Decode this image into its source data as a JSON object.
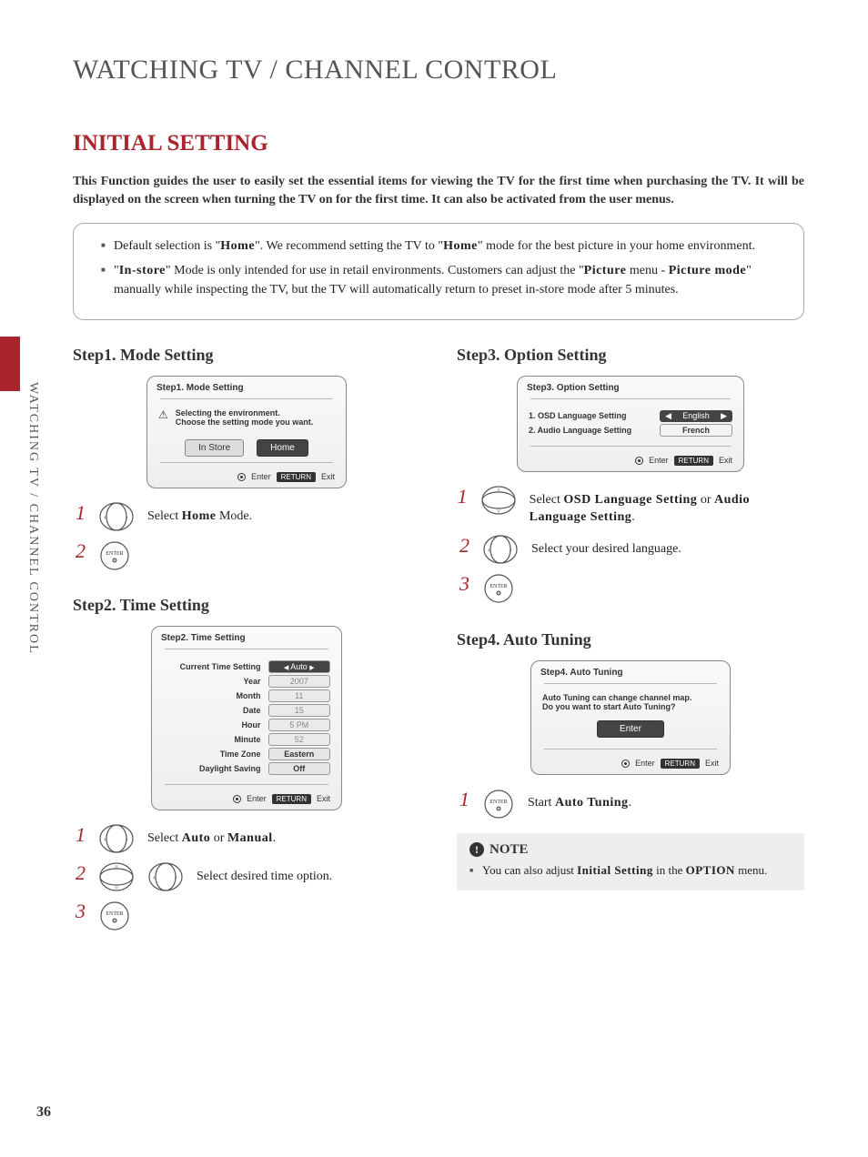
{
  "page": {
    "main_title": "WATCHING TV / CHANNEL CONTROL",
    "section_title": "INITIAL SETTING",
    "sidebar_label": "WATCHING TV / CHANNEL CONTROL",
    "page_number": "36"
  },
  "intro": "This Function guides the user to easily set the essential items for viewing the TV for the first time when purchasing the TV. It will be displayed on the screen when turning the TV on for the first time. It can also be activated from the user menus.",
  "info_bullets": {
    "b1_pre": "Default selection is \"",
    "b1_home": "Home",
    "b1_mid": "\". We recommend setting the TV to \"",
    "b1_home2": "Home",
    "b1_post": "\" mode for the best picture in your home environment.",
    "b2_pre": "\"",
    "b2_instore": "In-store",
    "b2_mid1": "\" Mode is only intended for use in retail environments. Customers can adjust the \"",
    "b2_pic": "Picture",
    "b2_mid2": " menu - ",
    "b2_picmode": "Picture mode",
    "b2_post": "\" manually while inspecting the TV, but the TV will automatically return to preset in-store mode after 5 minutes."
  },
  "step1": {
    "heading": "Step1. Mode Setting",
    "osd_title": "Step1. Mode Setting",
    "osd_msg1": "Selecting the environment.",
    "osd_msg2": "Choose the setting mode you want.",
    "btn_instore": "In Store",
    "btn_home": "Home",
    "instr1_pre": "Select ",
    "instr1_bold": "Home",
    "instr1_post": " Mode."
  },
  "step2": {
    "heading": "Step2. Time Setting",
    "osd_title": "Step2. Time Setting",
    "rows": [
      {
        "label": "Current Time Setting",
        "value": "Auto",
        "style": "dark_arrows"
      },
      {
        "label": "Year",
        "value": "2007",
        "style": "gray"
      },
      {
        "label": "Month",
        "value": "11",
        "style": "gray"
      },
      {
        "label": "Date",
        "value": "15",
        "style": "gray"
      },
      {
        "label": "Hour",
        "value": "5 PM",
        "style": "gray"
      },
      {
        "label": "Minute",
        "value": "52",
        "style": "gray"
      },
      {
        "label": "Time Zone",
        "value": "Eastern",
        "style": "bold"
      },
      {
        "label": "Daylight Saving",
        "value": "Off",
        "style": "bold"
      }
    ],
    "instr1_pre": "Select ",
    "instr1_b1": "Auto",
    "instr1_mid": " or ",
    "instr1_b2": "Manual",
    "instr1_post": ".",
    "instr2": "Select desired time option."
  },
  "step3": {
    "heading": "Step3. Option Setting",
    "osd_title": "Step3. Option Setting",
    "row1_label": "1. OSD Language Setting",
    "row1_value": "English",
    "row2_label": "2. Audio Language Setting",
    "row2_value": "French",
    "instr1_pre": "Select ",
    "instr1_b1": "OSD Language Setting",
    "instr1_mid": " or ",
    "instr1_b2": "Audio Language Setting",
    "instr1_post": ".",
    "instr2": "Select your desired language."
  },
  "step4": {
    "heading": "Step4. Auto Tuning",
    "osd_title": "Step4. Auto Tuning",
    "osd_msg1": "Auto Tuning can change channel map.",
    "osd_msg2": "Do you want to start Auto Tuning?",
    "btn_enter": "Enter",
    "instr1_pre": "Start ",
    "instr1_bold": "Auto Tuning",
    "instr1_post": "."
  },
  "footer": {
    "enter": "Enter",
    "return": "RETURN",
    "exit": "Exit"
  },
  "note": {
    "title": "NOTE",
    "body_pre": "You can also adjust ",
    "body_b1": "Initial Setting",
    "body_mid": " in the ",
    "body_b2": "OPTION",
    "body_post": " menu."
  },
  "remote": {
    "enter_label": "ENTER"
  }
}
